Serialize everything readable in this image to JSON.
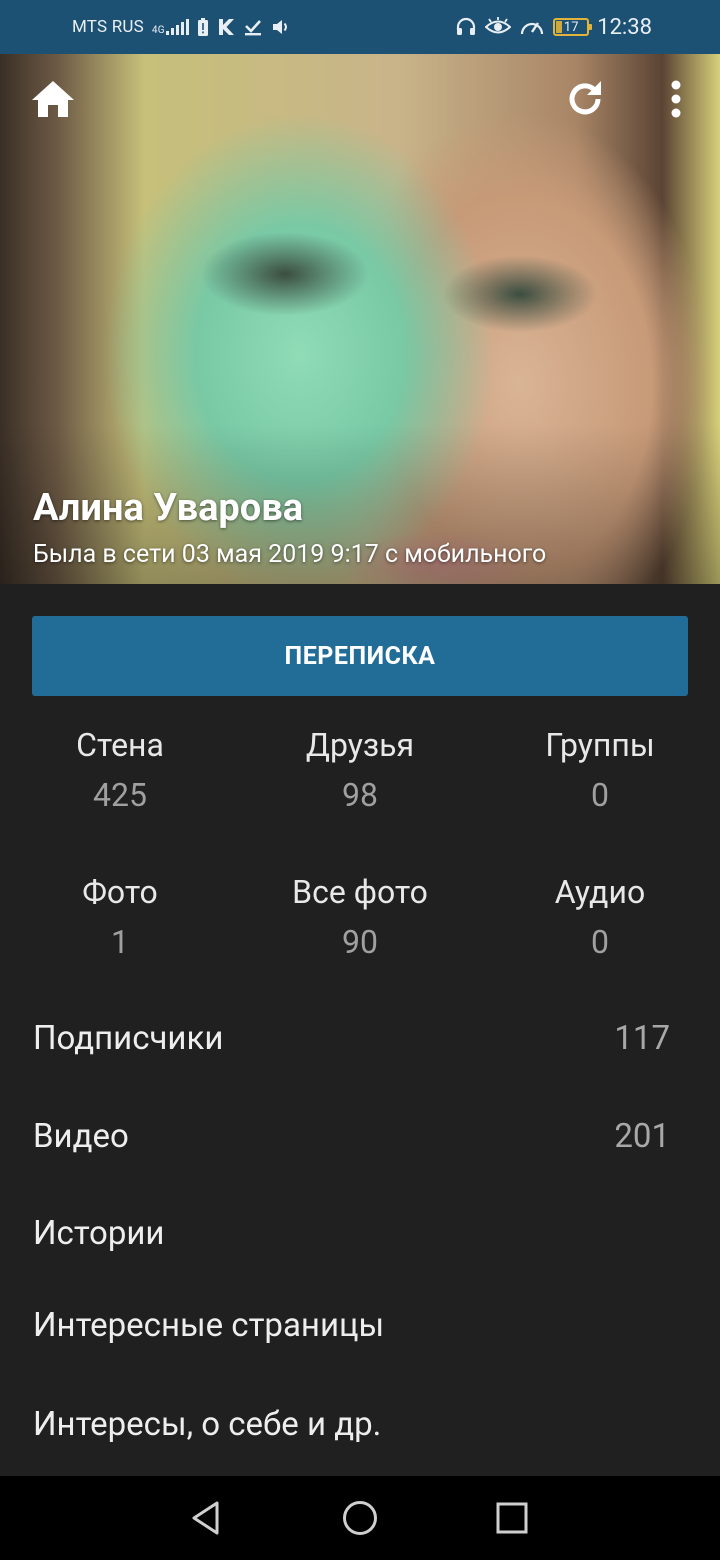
{
  "status_bar": {
    "carrier": "MTS RUS",
    "network_type": "4G",
    "battery_level": "17",
    "time": "12:38",
    "colors": {
      "background": "#1d5173",
      "battery": "#e2b33b"
    }
  },
  "header": {
    "name": "Алина Уварова",
    "last_seen": "Была в сети 03 мая 2019 9:17 с мобильного",
    "icons": {
      "home": "home-icon",
      "refresh": "refresh-icon",
      "more": "more-vert-icon"
    }
  },
  "message_button": {
    "label": "ПЕРЕПИСКА",
    "color": "#226d97"
  },
  "counters": [
    {
      "label": "Стена",
      "value": "425"
    },
    {
      "label": "Друзья",
      "value": "98"
    },
    {
      "label": "Группы",
      "value": "0"
    },
    {
      "label": "Фото",
      "value": "1"
    },
    {
      "label": "Все фото",
      "value": "90"
    },
    {
      "label": "Аудио",
      "value": "0"
    }
  ],
  "list": [
    {
      "label": "Подписчики",
      "value": "117"
    },
    {
      "label": "Видео",
      "value": "201"
    },
    {
      "label": "Истории",
      "value": ""
    },
    {
      "label": "Интересные страницы",
      "value": ""
    },
    {
      "label": "Интересы, о себе и др.",
      "value": ""
    }
  ],
  "nav_bar": {
    "icons": [
      "back-icon",
      "home-circle-icon",
      "recents-square-icon"
    ]
  }
}
